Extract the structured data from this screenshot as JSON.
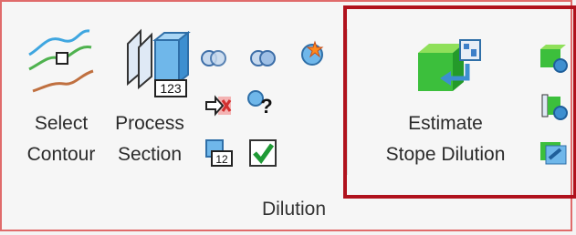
{
  "ribbon": {
    "group_label": "Dilution",
    "buttons": {
      "select_contour": {
        "line1": "Select",
        "line2": "Contour"
      },
      "process_section": {
        "line1": "Process",
        "line2": "Section",
        "badge": "123"
      },
      "estimate_stope_dilution": {
        "line1": "Estimate",
        "line2": "Stope Dilution"
      }
    },
    "small_icons": {
      "section_12_badge": "12",
      "question_mark": "?"
    }
  },
  "colors": {
    "highlight_border": "#b0121d",
    "ribbon_border": "#e06b6b",
    "accent_green": "#2fa82f"
  }
}
